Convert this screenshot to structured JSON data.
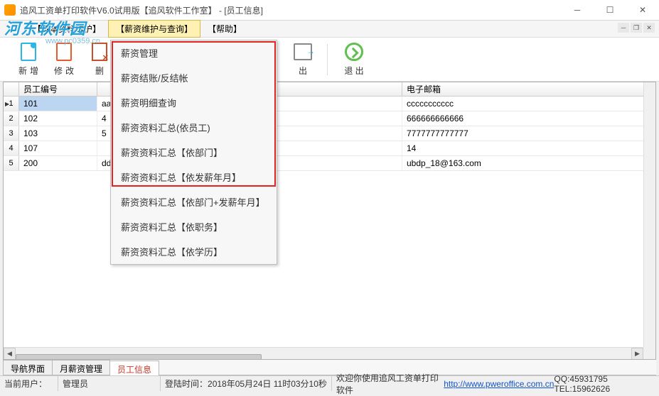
{
  "title": "追风工资单打印软件V6.0试用版【追风软件工作室】 - [员工信息]",
  "logo": {
    "main": "河东软件园",
    "sub": "www.pc0359.cn"
  },
  "menubar": [
    {
      "label": "【基本资料维护】"
    },
    {
      "label": "【薪资维护与查询】",
      "active": true
    },
    {
      "label": "【帮助】"
    }
  ],
  "toolbar": [
    {
      "key": "new",
      "label": "新增"
    },
    {
      "key": "edit",
      "label": "修改"
    },
    {
      "key": "delete",
      "label": "删"
    },
    {
      "key": "export",
      "label": "出"
    },
    {
      "key": "exit",
      "label": "退  出"
    }
  ],
  "dropdown": [
    "薪资管理",
    "薪资结账/反结帐",
    "薪资明细查询",
    "薪资资料汇总(依员工)",
    "薪资资料汇总【依部门】",
    "薪资资料汇总【依发薪年月】",
    "薪资资料汇总【依部门+发薪年月】",
    "薪资资料汇总【依职务】",
    "薪资资料汇总【依学历】"
  ],
  "grid": {
    "headers": [
      "员工编号",
      "",
      "电子邮箱"
    ],
    "rows": [
      {
        "no": "1",
        "id": "101",
        "mid_partial": "aaaaaaa",
        "email": "ccccccccccc",
        "selected": true
      },
      {
        "no": "2",
        "id": "102",
        "mid_partial": "4",
        "email": "666666666666"
      },
      {
        "no": "3",
        "id": "103",
        "mid_partial": "5",
        "email": "7777777777777"
      },
      {
        "no": "4",
        "id": "107",
        "mid_partial": "",
        "email": "14"
      },
      {
        "no": "5",
        "id": "200",
        "mid_partial": "dddddddddddddddsadf",
        "email": "ubdp_18@163.com"
      }
    ]
  },
  "tabs": [
    {
      "label": "导航界面"
    },
    {
      "label": "月薪资管理"
    },
    {
      "label": "员工信息",
      "active": true
    }
  ],
  "statusbar": {
    "user_label": "当前用户：",
    "user": "管理员",
    "time_label": "登陆时间：",
    "time": "2018年05月24日 11时03分10秒",
    "welcome": "欢迎你使用追风工资单打印软件 ",
    "link": "http://www.pweroffice.com.cn",
    "contact": " QQ:45931795 TEL:15962626"
  }
}
